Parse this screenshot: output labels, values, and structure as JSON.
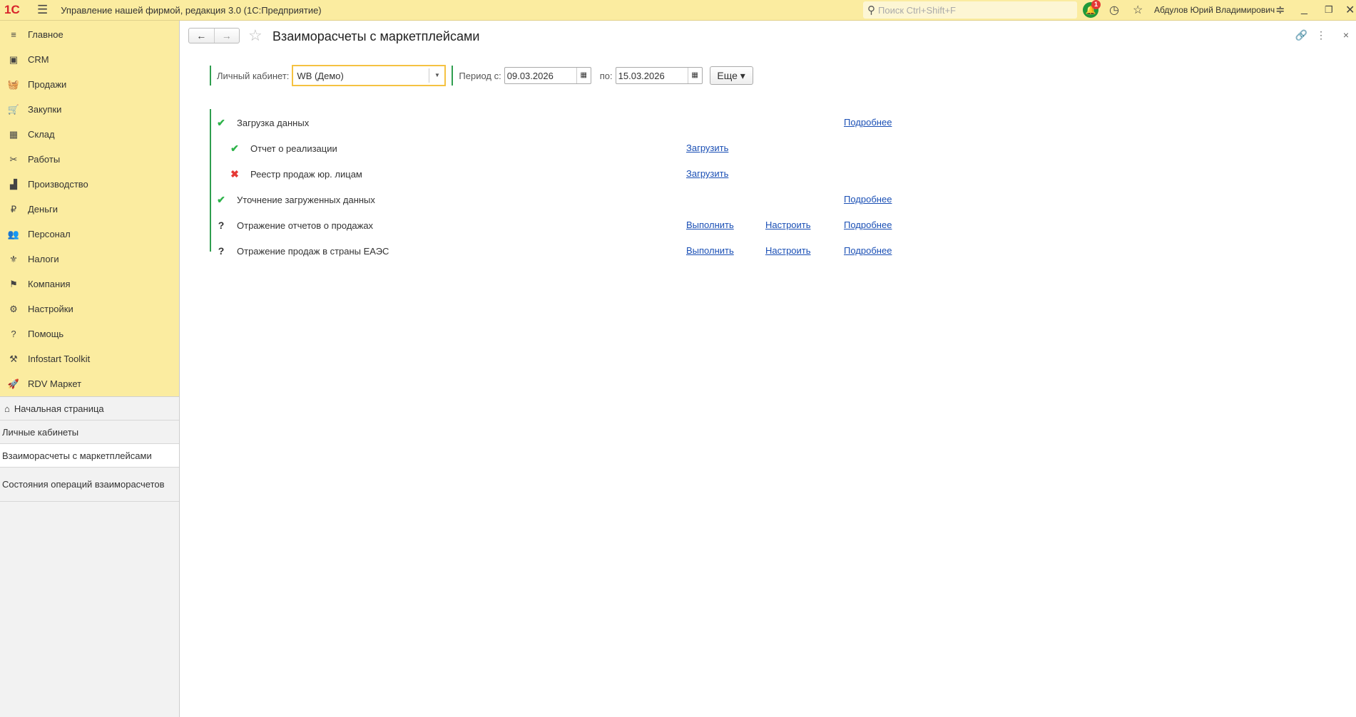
{
  "app": {
    "logo": "1С",
    "title": "Управление нашей фирмой, редакция 3.0  (1С:Предприятие)",
    "search_placeholder": "Поиск Ctrl+Shift+F",
    "notifications": "1",
    "user": "Абдулов Юрий Владимирович"
  },
  "sections": [
    {
      "label": "Главное",
      "icon": "≡"
    },
    {
      "label": "CRM",
      "icon": "▣"
    },
    {
      "label": "Продажи",
      "icon": "🧺"
    },
    {
      "label": "Закупки",
      "icon": "🛒"
    },
    {
      "label": "Склад",
      "icon": "▦"
    },
    {
      "label": "Работы",
      "icon": "✂"
    },
    {
      "label": "Производство",
      "icon": "▟"
    },
    {
      "label": "Деньги",
      "icon": "₽"
    },
    {
      "label": "Персонал",
      "icon": "👥"
    },
    {
      "label": "Налоги",
      "icon": "⚜"
    },
    {
      "label": "Компания",
      "icon": "⚑"
    },
    {
      "label": "Настройки",
      "icon": "⚙"
    },
    {
      "label": "Помощь",
      "icon": "?"
    },
    {
      "label": "Infostart Toolkit",
      "icon": "⚒"
    },
    {
      "label": "RDV Маркет",
      "icon": "🚀"
    }
  ],
  "open_windows": [
    "Начальная страница",
    "Личные кабинеты",
    "Взаиморасчеты с маркетплейсами",
    "Состояния операций взаиморасчетов"
  ],
  "page": {
    "title": "Взаиморасчеты с маркетплейсами",
    "filter": {
      "cabinet_label": "Личный кабинет:",
      "cabinet_value": "WB (Демо)",
      "period_from_label": "Период с:",
      "period_from": "09.03.2026",
      "period_to_label": "по:",
      "period_to": "15.03.2026",
      "more": "Еще"
    },
    "steps": [
      {
        "status": "ok",
        "label": "Загрузка данных",
        "details": "Подробнее"
      },
      {
        "status": "ok",
        "label": "Отчет о реализации",
        "load": "Загрузить"
      },
      {
        "status": "error",
        "label": "Реестр продаж юр. лицам",
        "load": "Загрузить"
      },
      {
        "status": "ok",
        "label": "Уточнение загруженных данных",
        "details": "Подробнее"
      },
      {
        "status": "unknown",
        "label": "Отражение отчетов о продажах",
        "run": "Выполнить",
        "setup": "Настроить",
        "details": "Подробнее"
      },
      {
        "status": "unknown",
        "label": "Отражение продаж в страны ЕАЭС",
        "run": "Выполнить",
        "setup": "Настроить",
        "details": "Подробнее"
      }
    ]
  }
}
